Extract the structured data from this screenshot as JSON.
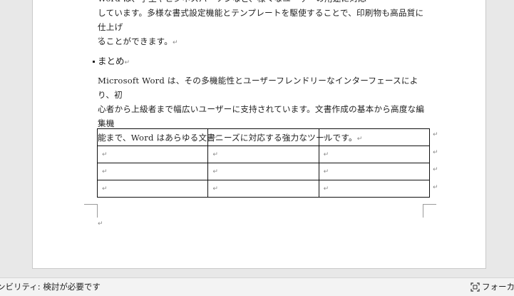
{
  "document": {
    "para1_line1": "Word は、学生やビジネスパーソンなど、様々なユーザーの用途に対応",
    "para1_line2": "しています。多様な書式設定機能とテンプレートを駆使することで、印刷物も高品質に仕上げ",
    "para1_line3": "ることができます。",
    "heading": "まとめ",
    "para2_line1": "Microsoft Word は、その多機能性とユーザーフレンドリーなインターフェースにより、初",
    "para2_line2": "心者から上級者まで幅広いユーザーに支持されています。文書作成の基本から高度な編集機",
    "para2_line3": "能まで、Word はあらゆる文書ニーズに対応する強力なツールです。",
    "paragraph_mark": "↵",
    "table": {
      "rows": [
        [
          "↵",
          "↵",
          "↵"
        ],
        [
          "↵",
          "↵",
          "↵"
        ],
        [
          "↵",
          "↵",
          "↵"
        ],
        [
          "↵",
          "↵",
          "↵"
        ]
      ]
    }
  },
  "statusbar": {
    "accessibility": "ンビリティ: 検討が必要です",
    "focus": "フォーカス"
  }
}
